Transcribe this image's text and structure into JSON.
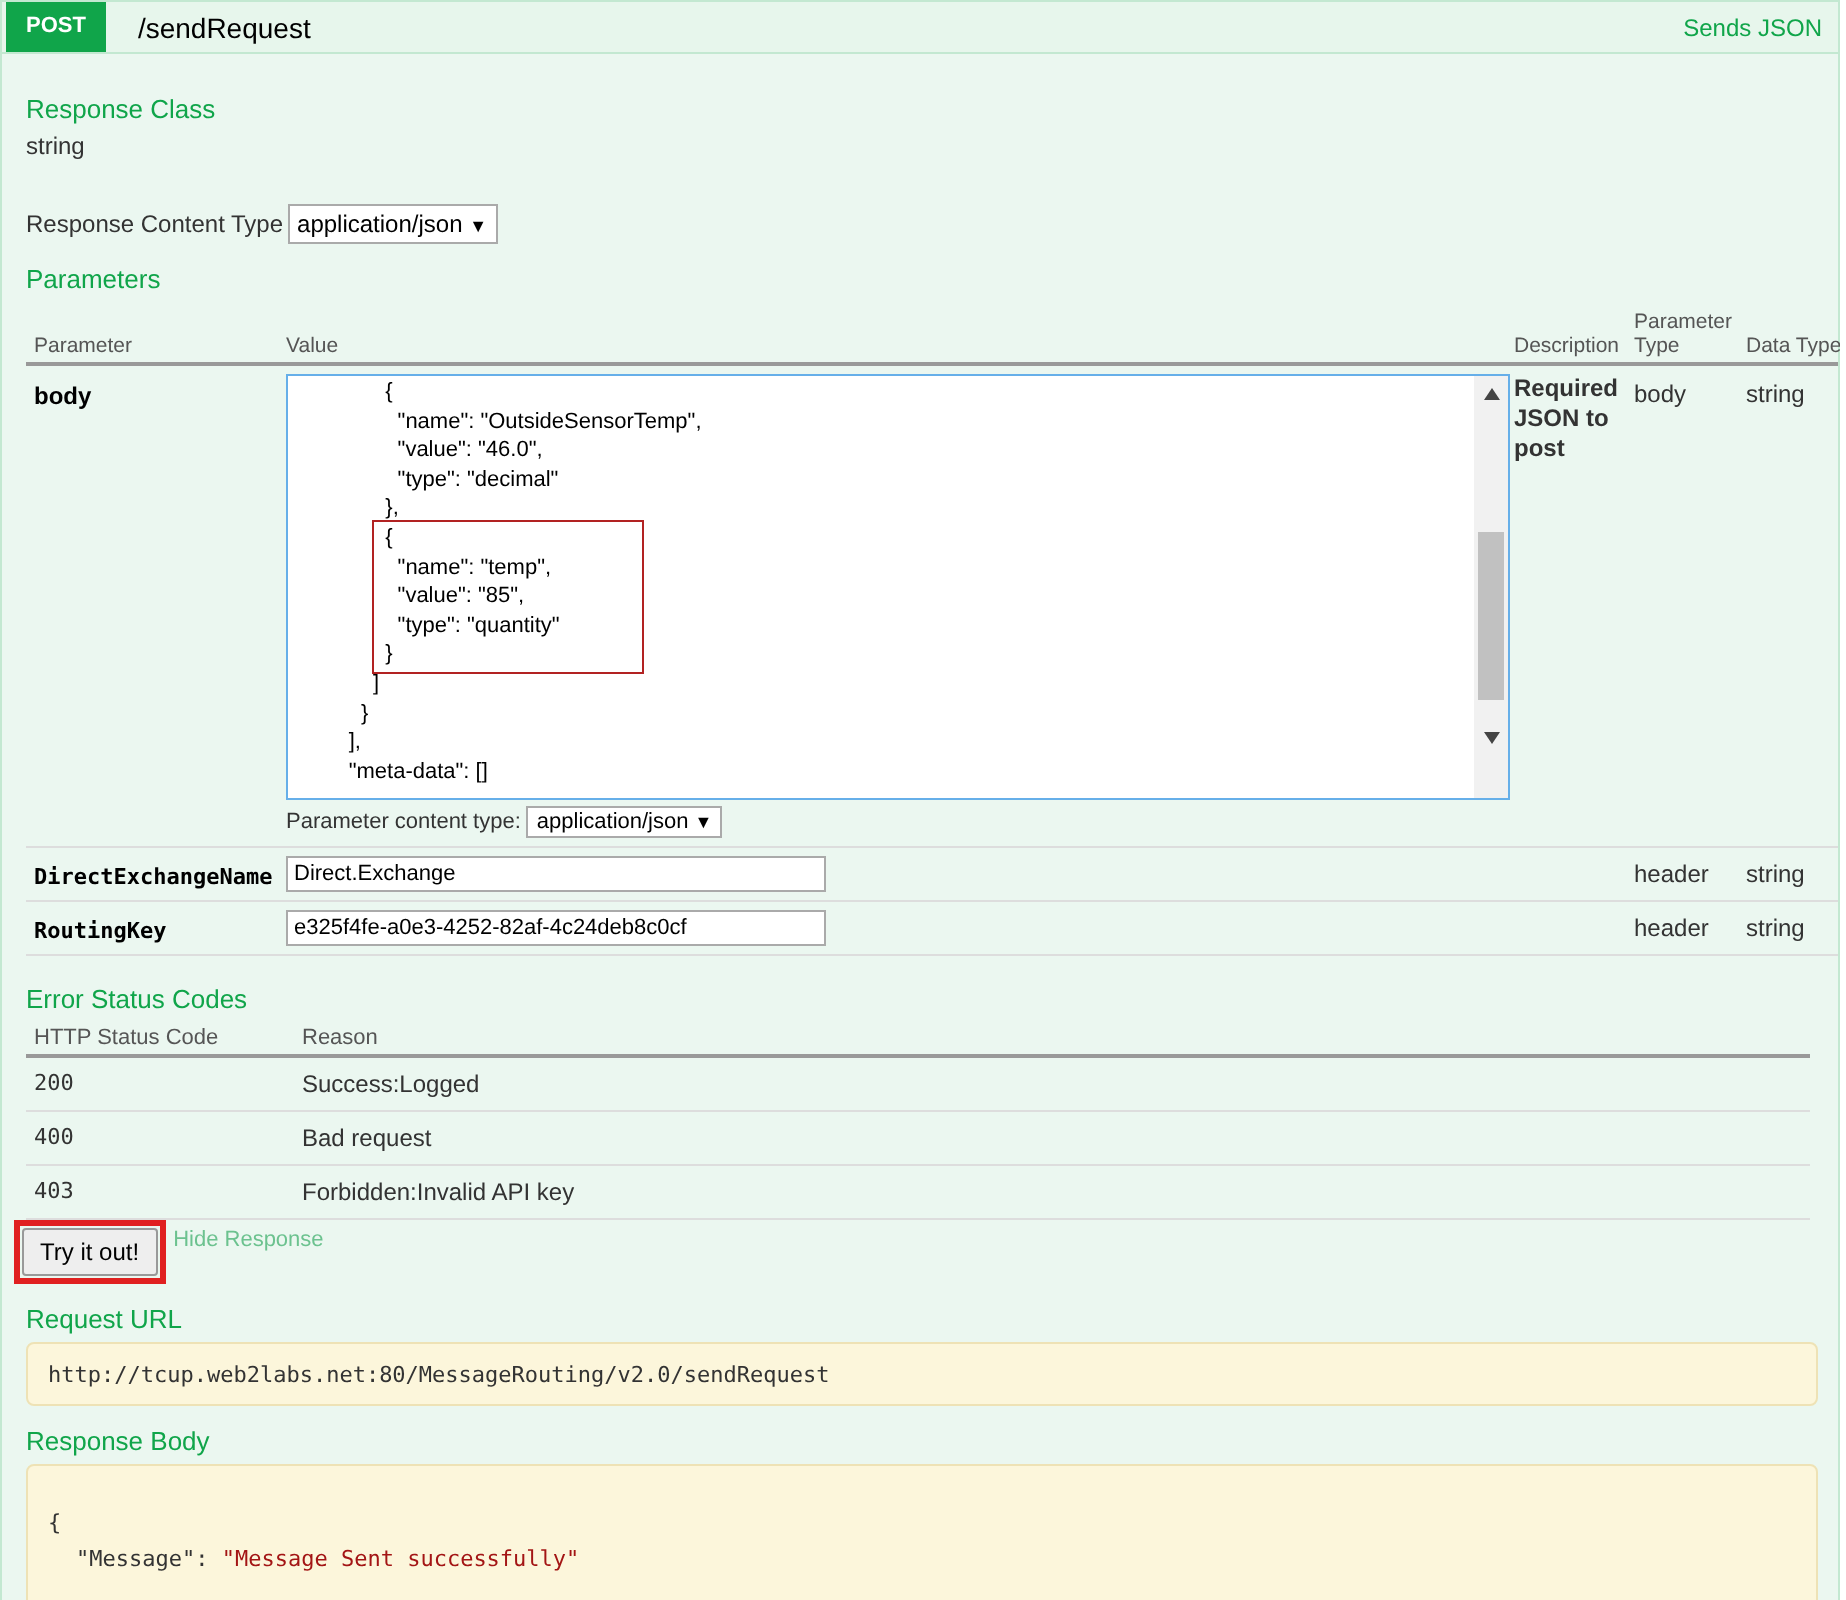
{
  "operation": {
    "method": "POST",
    "path": "/sendRequest",
    "summary": "Sends JSON"
  },
  "response_class": {
    "heading": "Response Class",
    "value": "string"
  },
  "response_content_type": {
    "label": "Response Content Type",
    "value": "application/json",
    "caret": "▼"
  },
  "parameters": {
    "heading": "Parameters",
    "columns": [
      "Parameter",
      "Value",
      "Description",
      "Parameter Type",
      "Data Type"
    ],
    "body": {
      "name": "body",
      "code_blocks": [
        {
          "highlighted": false,
          "lines": [
            "            {",
            "              \"name\": \"OutsideSensorTemp\",",
            "              \"value\": \"46.0\",",
            "              \"type\": \"decimal\"",
            "            },"
          ]
        },
        {
          "highlighted": true,
          "lines": [
            "            {",
            "              \"name\": \"temp\",",
            "              \"value\": \"85\",",
            "              \"type\": \"quantity\"",
            "            }"
          ]
        },
        {
          "highlighted": false,
          "lines": [
            "          ]",
            "        }",
            "      ],",
            "      \"meta-data\": []"
          ]
        }
      ],
      "content_type_label": "Parameter content type:",
      "content_type": "application/json",
      "caret": "▼",
      "description": "Required JSON to post",
      "param_type": "body",
      "data_type": "string"
    },
    "rows": [
      {
        "name": "DirectExchangeName",
        "value": "Direct.Exchange",
        "param_type": "header",
        "data_type": "string"
      },
      {
        "name": "RoutingKey",
        "value": "e325f4fe-a0e3-4252-82af-4c24deb8c0cf",
        "param_type": "header",
        "data_type": "string"
      }
    ]
  },
  "error_status_codes": {
    "heading": "Error Status Codes",
    "columns": [
      "HTTP Status Code",
      "Reason"
    ],
    "rows": [
      {
        "code": "200",
        "reason": "Success:Logged"
      },
      {
        "code": "400",
        "reason": "Bad request"
      },
      {
        "code": "403",
        "reason": "Forbidden:Invalid API key"
      }
    ]
  },
  "try_button": {
    "label": "Try it out!",
    "highlighted": true
  },
  "hide_response": "Hide Response",
  "request_url": {
    "heading": "Request URL",
    "value": "http://tcup.web2labs.net:80/MessageRouting/v2.0/sendRequest"
  },
  "response_body": {
    "heading": "Response Body",
    "lines": [
      {
        "kind": "punct",
        "text": "{"
      },
      {
        "kind": "pair",
        "key": "\"Message\"",
        "sep": ": ",
        "value": "\"Message Sent successfully\""
      }
    ]
  }
}
